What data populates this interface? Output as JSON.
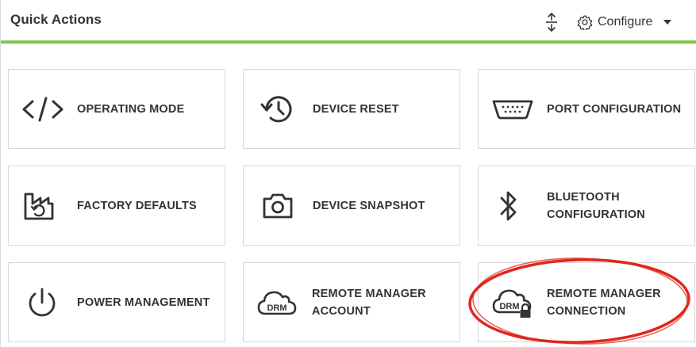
{
  "header": {
    "title": "Quick Actions",
    "collapse_icon": "expand-collapse-icon",
    "configure_label": "Configure",
    "accent_color": "#7dc84d"
  },
  "tiles": [
    {
      "label": "OPERATING MODE",
      "icon": "code-icon"
    },
    {
      "label": "DEVICE RESET",
      "icon": "history-icon"
    },
    {
      "label": "PORT CONFIGURATION",
      "icon": "serial-port-icon"
    },
    {
      "label": "FACTORY DEFAULTS",
      "icon": "factory-reset-icon"
    },
    {
      "label": "DEVICE SNAPSHOT",
      "icon": "camera-icon"
    },
    {
      "label_line1": "BLUETOOTH",
      "label_line2": "CONFIGURATION",
      "icon": "bluetooth-icon"
    },
    {
      "label": "POWER MANAGEMENT",
      "icon": "power-icon"
    },
    {
      "label_line1": "REMOTE MANAGER",
      "label_line2": "ACCOUNT",
      "icon": "drm-cloud-icon",
      "icon_text": "DRM"
    },
    {
      "label_line1": "REMOTE MANAGER",
      "label_line2": "CONNECTION",
      "icon": "drm-cloud-lock-icon",
      "icon_text": "DRM"
    }
  ],
  "annotation": {
    "highlight_color": "#e0261b",
    "highlighted_tile": "REMOTE MANAGER CONNECTION"
  }
}
